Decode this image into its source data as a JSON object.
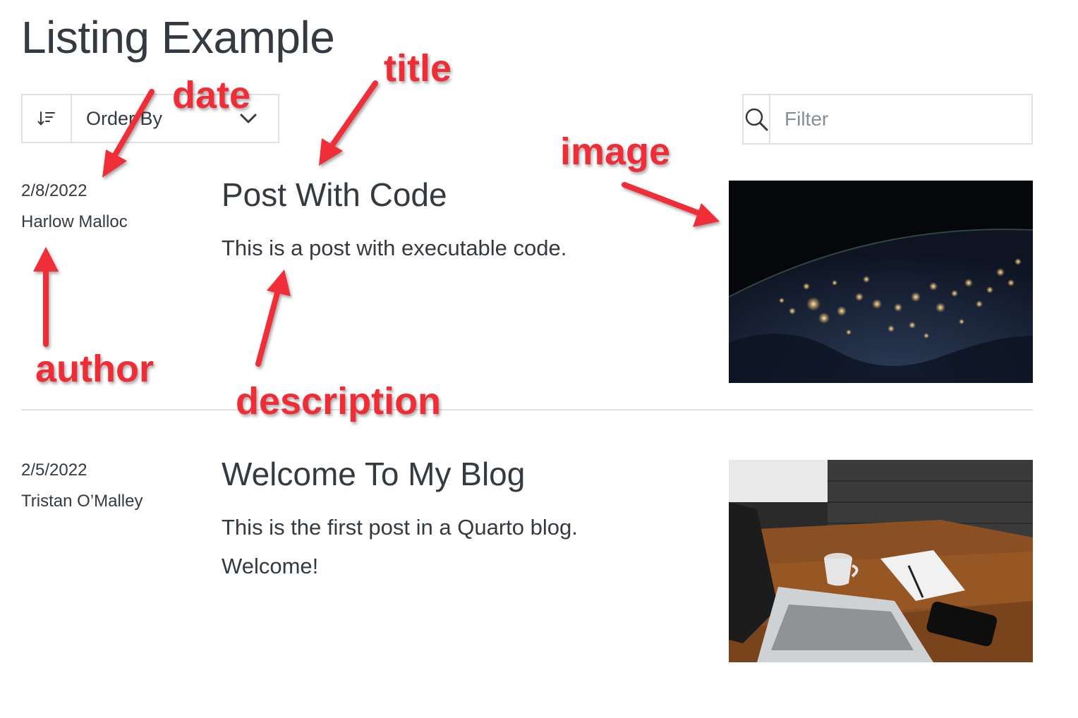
{
  "page": {
    "title": "Listing Example"
  },
  "toolbar": {
    "sort_label": "Order By",
    "filter_placeholder": "Filter"
  },
  "posts": [
    {
      "date": "2/8/2022",
      "author": "Harlow Malloc",
      "title": "Post With Code",
      "description": "This is a post with executable code."
    },
    {
      "date": "2/5/2022",
      "author": "Tristan O’Malley",
      "title": "Welcome To My Blog",
      "description": "This is the first post in a Quarto blog. Welcome!"
    }
  ],
  "annotations": {
    "date": "date",
    "title": "title",
    "image": "image",
    "author": "author",
    "description": "description"
  },
  "colors": {
    "annotation": "#f02d37",
    "text": "#343a40",
    "border": "#dee2e6"
  }
}
